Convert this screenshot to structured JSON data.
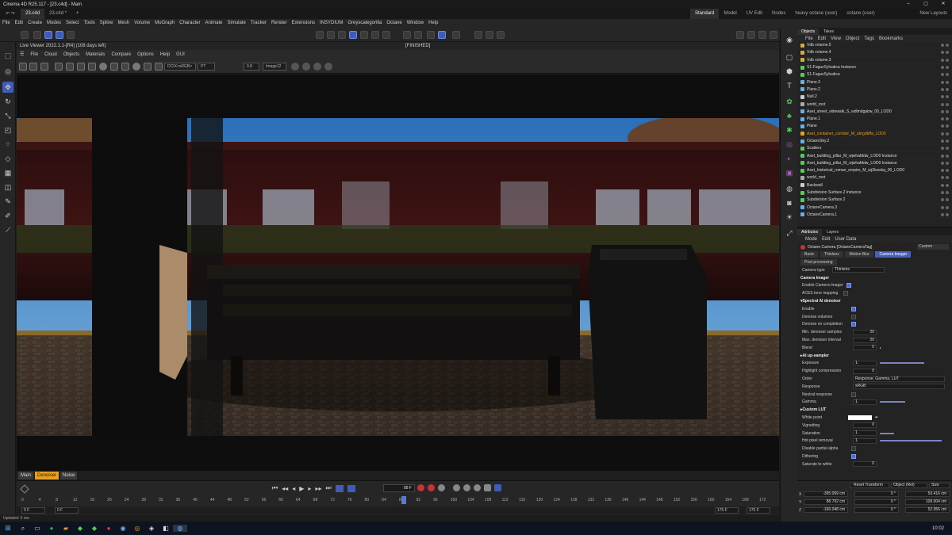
{
  "window": {
    "title": "Cinema 4D R25.117 - [23.c4d] - Main"
  },
  "tabs": [
    "23.c4d",
    "23.c4d *"
  ],
  "layouts": [
    "Standard",
    "Model",
    "UV Edit",
    "Nodes",
    "heavy octane (user)",
    "octane (user)"
  ],
  "new_layouts": "New Layouts",
  "menu": [
    "File",
    "Edit",
    "Create",
    "Modes",
    "Select",
    "Tools",
    "Spline",
    "Mesh",
    "Volume",
    "MoGraph",
    "Character",
    "Animate",
    "Simulate",
    "Tracker",
    "Render",
    "Extensions",
    "INSYDIUM",
    "Greyscalegorilla",
    "Octane",
    "Window",
    "Help"
  ],
  "live_viewer": {
    "title": "Live Viewer 2022.1.1-[R4] (108 days left)",
    "menu": [
      "File",
      "Cloud",
      "Objects",
      "Materials",
      "Compare",
      "Options",
      "Help",
      "GUI"
    ],
    "status": "[FINISHED]",
    "colorspace": "DCIX<sRGB>",
    "mode": "PT",
    "sample_val": "0.8",
    "image_label": "Image12",
    "tabs": [
      "Main",
      "Denoiser",
      "Noise"
    ],
    "active_tab": "Denoiser"
  },
  "timeline": {
    "ticks": [
      "0",
      "4",
      "8",
      "12",
      "16",
      "20",
      "24",
      "28",
      "32",
      "36",
      "40",
      "44",
      "48",
      "52",
      "56",
      "60",
      "64",
      "68",
      "72",
      "76",
      "80",
      "84",
      "88",
      "92",
      "96",
      "100",
      "104",
      "108",
      "112",
      "116",
      "120",
      "124",
      "128",
      "132",
      "136",
      "140",
      "144",
      "148",
      "152",
      "156",
      "160",
      "164",
      "168",
      "172"
    ],
    "current_frame": "88 F",
    "start": "0 F",
    "start2": "0 F",
    "end": "175 F",
    "end2": "175 F"
  },
  "status_text": "Updated: 0 ms.",
  "objects_panel": {
    "tabs": [
      "Objects",
      "Takes"
    ],
    "menu": [
      "File",
      "Edit",
      "View",
      "Object",
      "Tags",
      "Bookmarks"
    ],
    "items": [
      {
        "name": "Vdb volume.5",
        "color": "#d4a94a"
      },
      {
        "name": "Vdb volume.4",
        "color": "#d4a94a"
      },
      {
        "name": "Vdb volume.3",
        "color": "#d4a94a"
      },
      {
        "name": "S1-FagusSylvatica Instance",
        "color": "#5ac85a"
      },
      {
        "name": "S1-FagusSylvatica",
        "color": "#5ac85a"
      },
      {
        "name": "Plane.3",
        "color": "#6ab0e6"
      },
      {
        "name": "Plane.2",
        "color": "#6ab0e6"
      },
      {
        "name": "Null.2",
        "color": "#cccccc"
      },
      {
        "name": "world_root",
        "color": "#aaaaaa"
      },
      {
        "name": "Aset_street_sidewalk_S_wdlmdgabw_00_LOD0",
        "color": "#6ab0e6"
      },
      {
        "name": "Plane.1",
        "color": "#6ab0e6"
      },
      {
        "name": "Plane",
        "color": "#6ab0e6"
      },
      {
        "name": "Aset_container_corridor_M_ubrgdbffa_LOD0",
        "color": "#e8a020"
      },
      {
        "name": "OctaneSky.2",
        "color": "#6ab0e6"
      },
      {
        "name": "Scatters",
        "color": "#5ac85a"
      },
      {
        "name": "Aset_building_pillar_M_wjwhafddw_LOD0 Instance",
        "color": "#5ac85a"
      },
      {
        "name": "Aset_building_pillar_M_wjwhafddw_LOD0 Instance",
        "color": "#5ac85a"
      },
      {
        "name": "Aset_historical_roman_empire_M_wj3loxskq_00_LOD0",
        "color": "#5ac85a"
      },
      {
        "name": "world_root",
        "color": "#aaaaaa"
      },
      {
        "name": "Backwall",
        "color": "#cccccc"
      },
      {
        "name": "Subdivision Surface.2 Instance",
        "color": "#5ac85a"
      },
      {
        "name": "Subdivision Surface.2",
        "color": "#5ac85a"
      },
      {
        "name": "OctaneCamera.3",
        "color": "#6ab0e6"
      },
      {
        "name": "OctaneCamera.1",
        "color": "#6ab0e6"
      }
    ]
  },
  "attributes": {
    "tabs": [
      "Attributes",
      "Layers"
    ],
    "menu": [
      "Mode",
      "Edit",
      "User Data"
    ],
    "object_title": "Octane Camera [OctaneCameraTag]",
    "preset": "Custom",
    "cam_tabs": [
      "Basic",
      "Thinlens",
      "Motion Blur",
      "Camera Imager",
      "Post processing"
    ],
    "active_cam_tab": "Camera Imager",
    "camera_type_label": "Camera type",
    "camera_type": "Thinlens",
    "section_imager": "Camera Imager",
    "enable_imager": "Enable Camera Imager",
    "aces": "ACES tone mapping",
    "section_denoiser": "Spectral AI denoiser",
    "enable": "Enable",
    "denoise_volumes": "Denoise volumes",
    "denoise_completion": "Denoise on completion",
    "min_samples_label": "Min. denoiser samples",
    "min_samples": "20",
    "max_interval_label": "Max. denoiser interval",
    "max_interval": "20",
    "blend_label": "Blend",
    "blend": "0",
    "section_upsampler": "AI up-sampler",
    "exposure_label": "Exposure",
    "exposure": "1.",
    "highlight_label": "Highlight compression",
    "highlight": "0",
    "order_label": "Order",
    "order": "Response, Gamma, LUT",
    "response_label": "Response",
    "response": "sRGB",
    "neutral_label": "Neutral response",
    "gamma_label": "Gamma",
    "gamma": "1.",
    "section_lut": "Custom LUT",
    "white_point_label": "White point",
    "vignetting_label": "Vignetting",
    "vignetting": "0",
    "saturation_label": "Saturation",
    "saturation": "1.",
    "hotpixel_label": "Hot pixel removal",
    "hotpixel": "1.",
    "disable_alpha_label": "Disable partial alpha",
    "dithering_label": "Dithering",
    "saturate_white_label": "Saturate to white",
    "saturate_white": "0"
  },
  "coords": {
    "reset": "Reset Transform",
    "space": "Object (Rel)",
    "size_mode": "Size",
    "x": "-395.099 cm",
    "y": "88.792 cm",
    "z": "-166.048 cm",
    "rx": "0 °",
    "ry": "0 °",
    "rz": "0 °",
    "sx": "53.416 cm",
    "sy": "109.004 cm",
    "sz": "52.956 cm"
  },
  "taskbar": {
    "time": "10:02"
  }
}
